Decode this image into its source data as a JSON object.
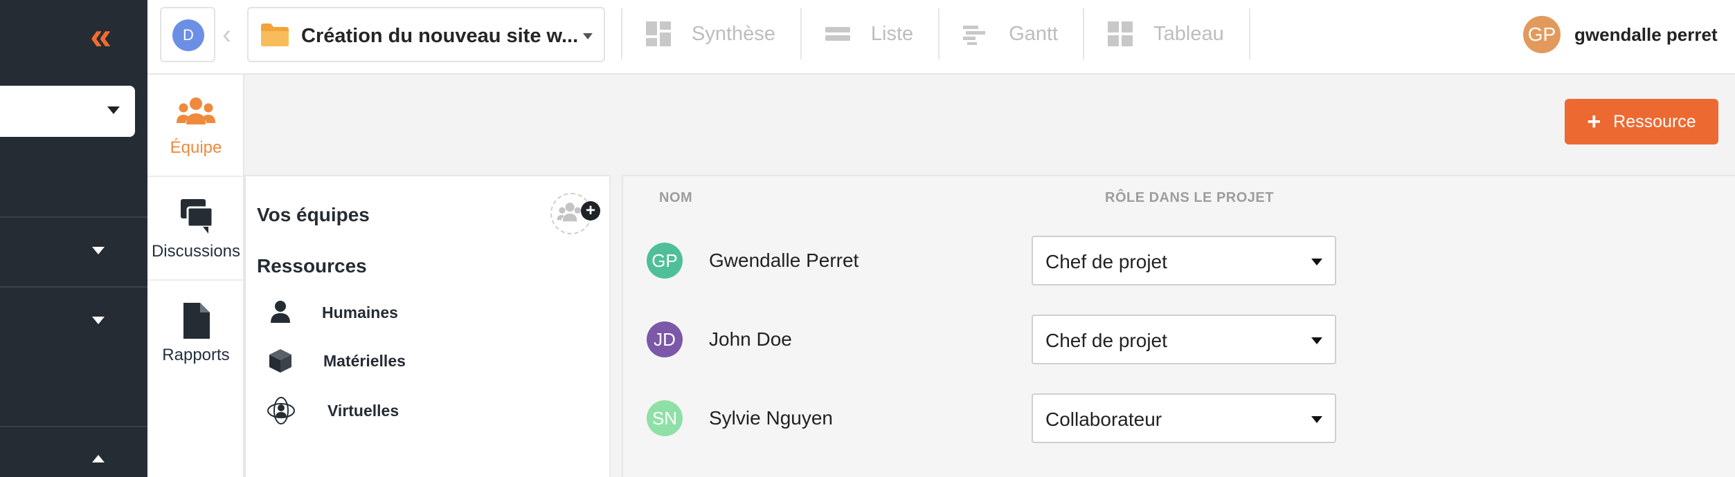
{
  "sidebar": {
    "collapse_icon": "double-chevron-left-icon"
  },
  "topbar": {
    "workspace_avatar": "D",
    "project_name": "Création du nouveau site w...",
    "tabs": [
      {
        "label": "Synthèse",
        "icon": "synthesis-icon"
      },
      {
        "label": "Liste",
        "icon": "list-icon"
      },
      {
        "label": "Gantt",
        "icon": "gantt-icon"
      },
      {
        "label": "Tableau",
        "icon": "board-icon"
      }
    ],
    "user": {
      "initials": "GP",
      "name": "gwendalle perret"
    }
  },
  "nav": {
    "items": [
      {
        "label": "Équipe",
        "icon": "team-icon"
      },
      {
        "label": "Discussions",
        "icon": "chat-icon"
      },
      {
        "label": "Rapports",
        "icon": "report-icon"
      }
    ]
  },
  "toolbar": {
    "add_resource_label": "Ressource",
    "add_resource_plus": "+"
  },
  "teams": {
    "title": "Vos équipes",
    "resources_title": "Ressources",
    "resource_types": [
      {
        "label": "Humaines",
        "icon": "person-icon"
      },
      {
        "label": "Matérielles",
        "icon": "cube-icon"
      },
      {
        "label": "Virtuelles",
        "icon": "virtual-icon"
      }
    ]
  },
  "members": {
    "columns": {
      "name": "NOM",
      "role": "RÔLE DANS LE PROJET"
    },
    "rows": [
      {
        "initials": "GP",
        "name": "Gwendalle Perret",
        "role": "Chef de projet",
        "color": "#4fbf9a"
      },
      {
        "initials": "JD",
        "name": "John Doe",
        "role": "Chef de projet",
        "color": "#7b58a8"
      },
      {
        "initials": "SN",
        "name": "Sylvie Nguyen",
        "role": "Collaborateur",
        "color": "#8fe0a6"
      }
    ]
  },
  "colors": {
    "accent": "#ec6932",
    "dark_sidebar": "#252c33",
    "active_nav": "#ef8a3c"
  }
}
